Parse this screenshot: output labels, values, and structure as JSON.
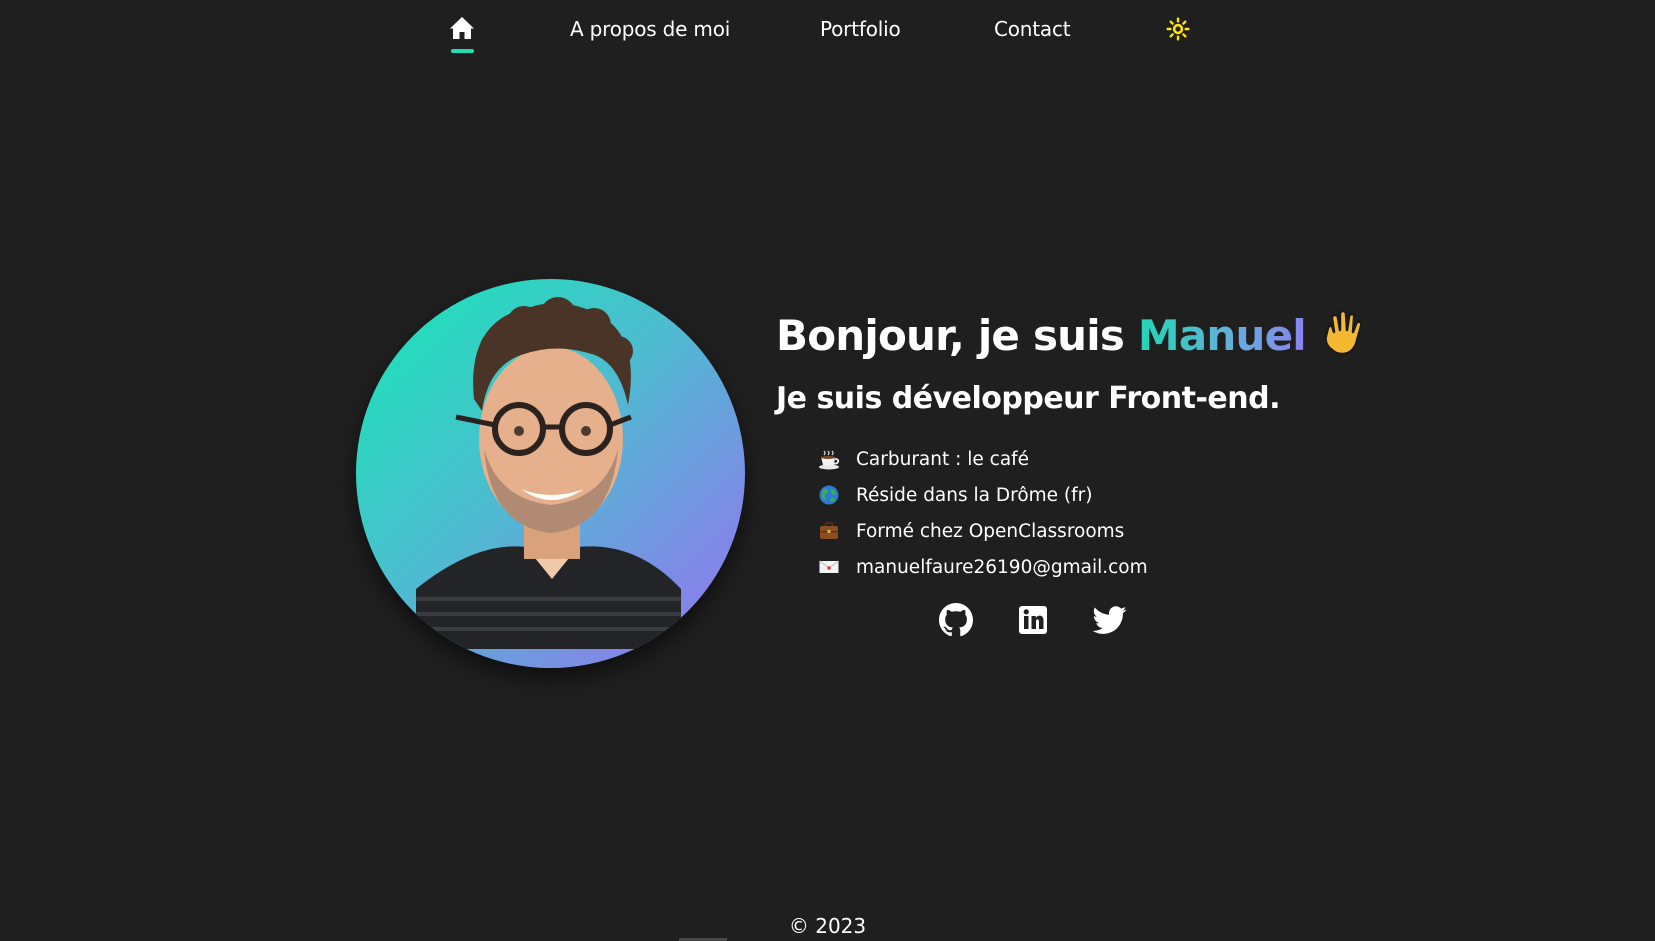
{
  "nav": {
    "home_icon": "home-icon",
    "links": [
      "A propos de moi",
      "Portfolio",
      "Contact"
    ],
    "theme_icon": "sun-icon",
    "active_color": "#1fe0b5",
    "theme_icon_color": "#ffe600"
  },
  "hero": {
    "greeting": "Bonjour, je suis ",
    "name": "Manuel",
    "wave_icon": "waving-hand-icon",
    "subtitle": "Je suis développeur Front-end.",
    "gradient": [
      "#14e8b4",
      "#8d7bf0"
    ]
  },
  "info": [
    {
      "icon": "coffee-icon",
      "text": "Carburant : le café"
    },
    {
      "icon": "globe-icon",
      "text": "Réside dans la Drôme (fr)"
    },
    {
      "icon": "briefcase-icon",
      "text": "Formé chez OpenClassrooms"
    },
    {
      "icon": "envelope-icon",
      "text": "manuelfaure26190@gmail.com"
    }
  ],
  "social": [
    "github-icon",
    "linkedin-icon",
    "twitter-icon"
  ],
  "footer": {
    "copyright": "© 2023"
  },
  "colors": {
    "background": "#1f1f1f",
    "text": "#ffffff"
  }
}
